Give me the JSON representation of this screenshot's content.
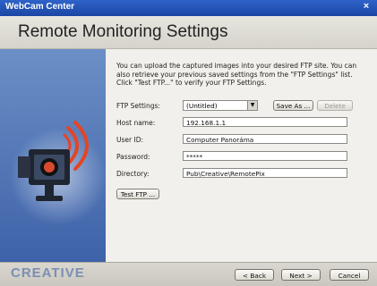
{
  "window": {
    "title": "WebCam Center",
    "close_glyph": "×"
  },
  "header": {
    "title": "Remote Monitoring Settings"
  },
  "description": "You can upload the captured images into your desired FTP site.  You can also retrieve your previous saved settings from the \"FTP Settings\" list. Click \"Test FTP...\" to verify your FTP Settings.",
  "form": {
    "ftp_settings_label": "FTP Settings:",
    "ftp_settings_value": "(Untitled)",
    "save_as_label": "Save As ...",
    "delete_label": "Delete",
    "host_label": "Host name:",
    "host_value": "192.168.1.1",
    "user_label": "User ID:",
    "user_value": "Computer Panoráma",
    "password_label": "Password:",
    "password_value": "*****",
    "directory_label": "Directory:",
    "directory_value": "Pub\\Creative\\RemotePix",
    "test_ftp_label": "Test FTP ..."
  },
  "footer": {
    "brand": "CREATIVE",
    "back_label": "< Back",
    "next_label": "Next >",
    "cancel_label": "Cancel"
  },
  "icons": {
    "camera": "webcam-icon",
    "signal": "signal-waves-icon",
    "dropdown": "chevron-down-icon"
  },
  "colors": {
    "titlebar": "#1f4fb5",
    "left_panel": "#4f73b7",
    "camera_accent": "#d84a2e",
    "signal": "#e44523"
  }
}
